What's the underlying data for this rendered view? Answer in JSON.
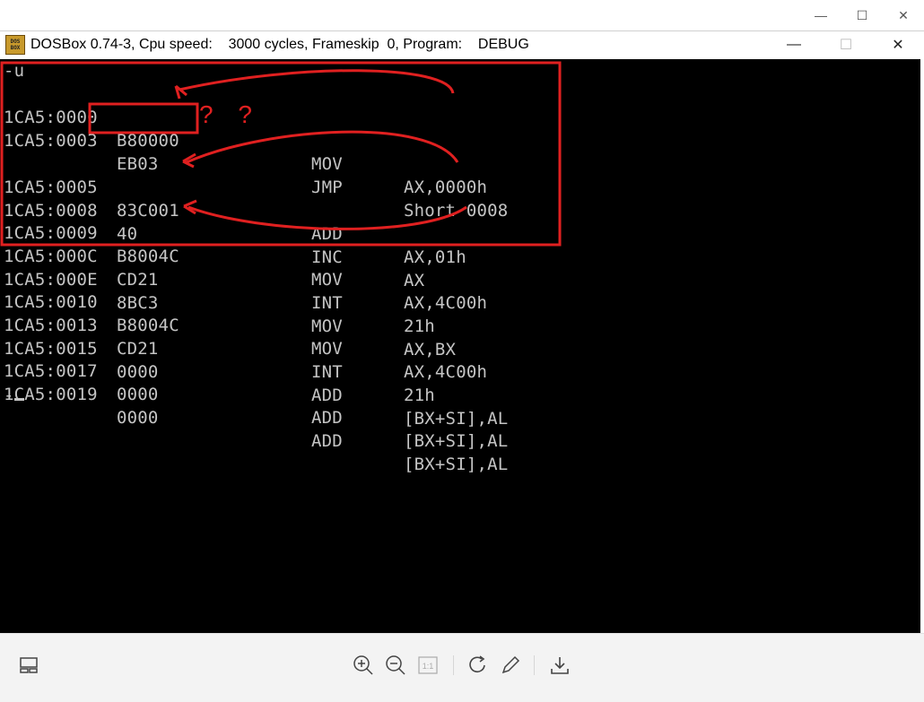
{
  "viewer": {
    "controls": {
      "minimize": "—",
      "maximize": "☐",
      "close": "✕"
    }
  },
  "dosbox": {
    "logo_top": "DOS",
    "logo_bottom": "BOX",
    "title": "DOSBox 0.74-3, Cpu speed:    3000 cycles, Frameskip  0, Program:    DEBUG",
    "controls": {
      "minimize": "—",
      "maximize": "☐",
      "close": "✕"
    }
  },
  "terminal": {
    "command": "-u",
    "rows": [
      {
        "addr": "1CA5:0000",
        "hex": "B80000",
        "mnemonic": "MOV",
        "operands": "AX,0000h"
      },
      {
        "addr": "1CA5:0003",
        "hex": "EB03",
        "mnemonic": "JMP",
        "operands": "Short 0008"
      },
      {
        "addr": "1CA5:0005",
        "hex": "83C001",
        "mnemonic": "ADD",
        "operands": "AX,01h"
      },
      {
        "addr": "1CA5:0008",
        "hex": "40",
        "mnemonic": "INC",
        "operands": "AX"
      },
      {
        "addr": "1CA5:0009",
        "hex": "B8004C",
        "mnemonic": "MOV",
        "operands": "AX,4C00h"
      },
      {
        "addr": "1CA5:000C",
        "hex": "CD21",
        "mnemonic": "INT",
        "operands": "21h"
      },
      {
        "addr": "1CA5:000E",
        "hex": "8BC3",
        "mnemonic": "MOV",
        "operands": "AX,BX"
      },
      {
        "addr": "1CA5:0010",
        "hex": "B8004C",
        "mnemonic": "MOV",
        "operands": "AX,4C00h"
      },
      {
        "addr": "1CA5:0013",
        "hex": "CD21",
        "mnemonic": "INT",
        "operands": "21h"
      },
      {
        "addr": "1CA5:0015",
        "hex": "0000",
        "mnemonic": "ADD",
        "operands": "[BX+SI],AL"
      },
      {
        "addr": "1CA5:0017",
        "hex": "0000",
        "mnemonic": "ADD",
        "operands": "[BX+SI],AL"
      },
      {
        "addr": "1CA5:0019",
        "hex": "0000",
        "mnemonic": "ADD",
        "operands": "[BX+SI],AL"
      }
    ],
    "prompt": "-"
  },
  "annotation": {
    "question_marks": "? ?",
    "color": "#e02020"
  },
  "toolbar": {
    "icons": [
      "thumbnail-icon",
      "zoom-in-icon",
      "zoom-out-icon",
      "actual-size-icon",
      "rotate-icon",
      "edit-icon",
      "download-icon"
    ],
    "actual_size_label": "1:1"
  }
}
